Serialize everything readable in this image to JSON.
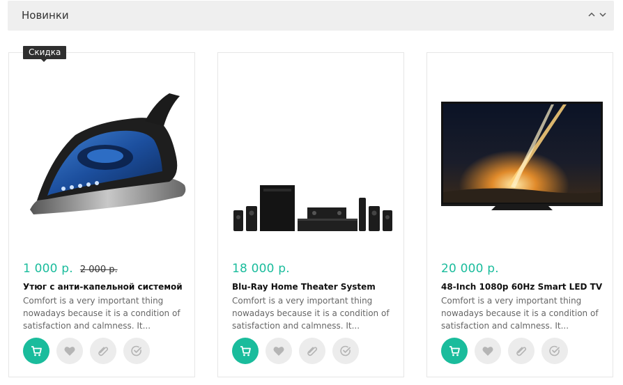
{
  "section": {
    "title": "Новинки"
  },
  "products": [
    {
      "badge": "Скидка",
      "price": "1 000 р.",
      "old_price": "2 000 р.",
      "title": "Утюг с анти-капельной системой",
      "desc": "Comfort is a very important thing nowadays because it is a condition of satisfaction and calmness. It...",
      "image_icon": "steam-iron"
    },
    {
      "price": "18 000 р.",
      "title": "Blu-Ray Home Theater System",
      "desc": "Comfort is a very important thing nowadays because it is a condition of satisfaction and calmness. It...",
      "image_icon": "home-theater"
    },
    {
      "price": "20 000 р.",
      "title": "48-Inch 1080p 60Hz Smart LED TV",
      "desc": "Comfort is a very important thing nowadays because it is a condition of satisfaction and calmness. It...",
      "image_icon": "led-tv"
    }
  ],
  "actions": [
    "cart-icon",
    "heart-icon",
    "paperclip-icon",
    "compare-check-icon"
  ],
  "colors": {
    "accent": "#1abc9c",
    "badge_bg": "#2f2f2f",
    "header_bg": "#efefef"
  }
}
